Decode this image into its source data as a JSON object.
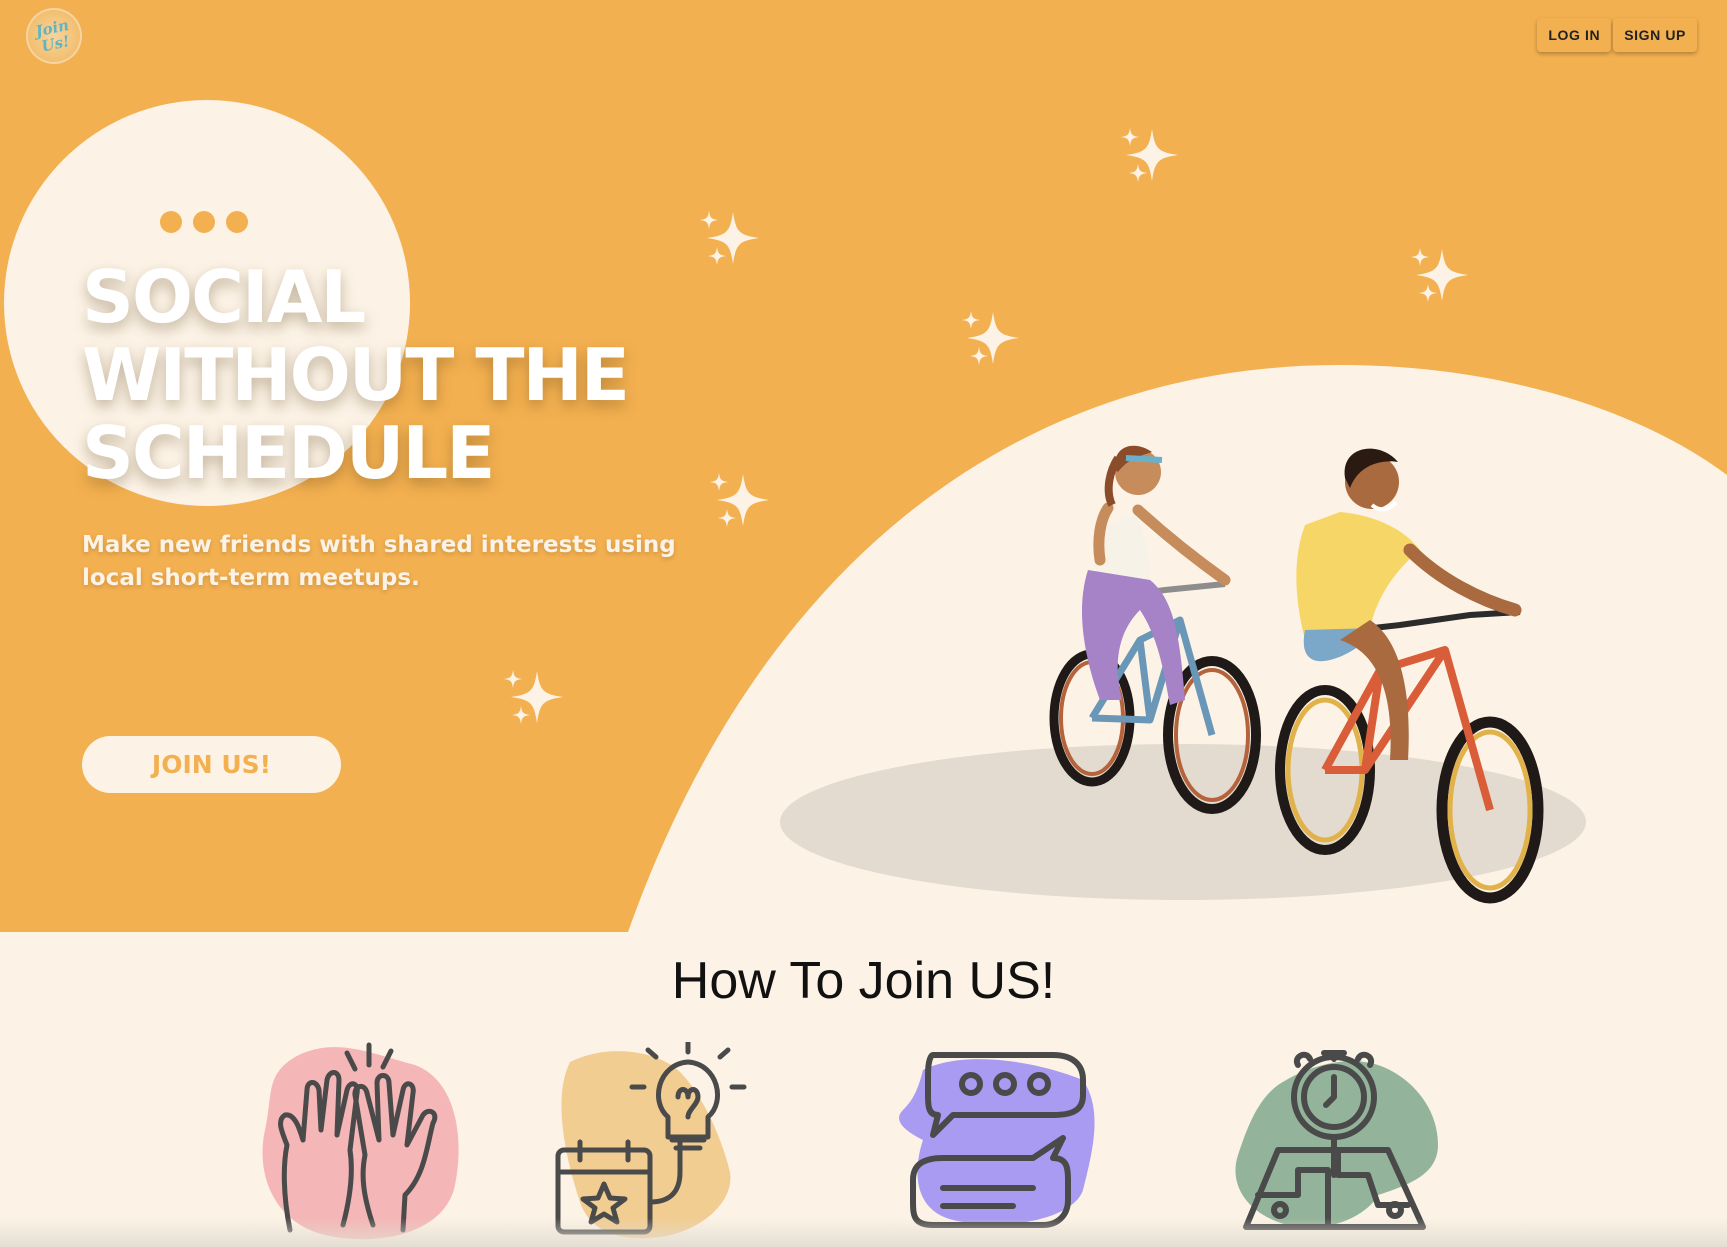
{
  "header": {
    "logo_text": "Join\nUs!",
    "login_label": "LOG IN",
    "signup_label": "SIGN UP"
  },
  "hero": {
    "headline": "SOCIAL\nWITHOUT THE\nSCHEDULE",
    "subtitle": "Make new friends with shared interests using local short-term meetups.",
    "cta_label": "JOIN US!",
    "illustration": "two-people-cycling"
  },
  "how_to_join": {
    "title": "How To Join US!",
    "steps": [
      {
        "icon": "high-five-icon",
        "blob_color": "#f4b6b6"
      },
      {
        "icon": "idea-calendar-icon",
        "blob_color": "#f2cd92"
      },
      {
        "icon": "chat-bubbles-icon",
        "blob_color": "#a99af2"
      },
      {
        "icon": "stopwatch-map-icon",
        "blob_color": "#93b39b"
      }
    ]
  },
  "colors": {
    "primary": "#f3b050",
    "cream": "#fcf3e6",
    "text_dark": "#111111"
  }
}
